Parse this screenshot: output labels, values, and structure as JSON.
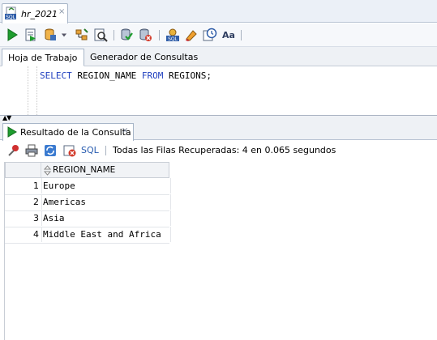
{
  "document_tab": {
    "title": "hr_2021",
    "close": "×",
    "icon": "sql-file-icon"
  },
  "toolbar": {
    "icons": [
      "run-statement-icon",
      "run-script-icon",
      "commit-icon",
      "dropdown-icon",
      "explain-plan-icon",
      "autotrace-icon",
      "commit-transaction-icon",
      "rollback-icon",
      "sql-tuning-icon",
      "clear-icon",
      "history-icon",
      "format-case-icon"
    ],
    "case_label": "Aa"
  },
  "worksheet_tabs": [
    {
      "label": "Hoja de Trabajo",
      "active": true
    },
    {
      "label": "Generador de Consultas",
      "active": false
    }
  ],
  "editor": {
    "tokens": [
      {
        "text": "SELECT",
        "kw": true
      },
      {
        "text": " REGION_NAME ",
        "kw": false
      },
      {
        "text": "FROM",
        "kw": true
      },
      {
        "text": " REGIONS;",
        "kw": false
      }
    ]
  },
  "result_tab": {
    "label": "Resultado de la Consulta",
    "close": "×"
  },
  "result_toolbar": {
    "sql_link": "SQL",
    "status": "Todas las Filas Recuperadas: 4 en 0.065 segundos"
  },
  "grid": {
    "columns": [
      "REGION_NAME"
    ],
    "rows": [
      {
        "n": "1",
        "REGION_NAME": "Europe"
      },
      {
        "n": "2",
        "REGION_NAME": "Americas"
      },
      {
        "n": "3",
        "REGION_NAME": "Asia"
      },
      {
        "n": "4",
        "REGION_NAME": "Middle East and Africa"
      }
    ]
  },
  "colors": {
    "keyword": "#1f3fbf",
    "run_green": "#1e9d2e",
    "link_blue": "#2a5db0"
  }
}
